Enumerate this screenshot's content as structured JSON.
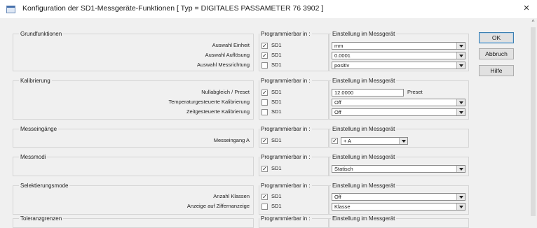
{
  "window": {
    "title": "Konfiguration der SD1-Messgeräte-Funktionen  [ Typ = DIGITALES PASSAMETER 76 3902 ]",
    "close_glyph": "×"
  },
  "column_headers": {
    "programmierbar": "Programmierbar in :",
    "einstellung": "Einstellung im Messgerät"
  },
  "sections": [
    {
      "title": "Grundfunktionen",
      "rows": [
        {
          "label": "Auswahl Einheit",
          "checked": true,
          "sd": "SD1",
          "value": "mm"
        },
        {
          "label": "Auswahl Auflösung",
          "checked": true,
          "sd": "SD1",
          "value": "0.0001"
        },
        {
          "label": "Auswahl Messrichtung",
          "checked": false,
          "sd": "SD1",
          "value": "positiv"
        }
      ]
    },
    {
      "title": "Kalibrierung",
      "rows": [
        {
          "label": "Nullabgleich / Preset",
          "checked": true,
          "sd": "SD1",
          "value": "12.0000",
          "suffix": "Preset"
        },
        {
          "label": "Temperaturgesteuerte Kalibrierung",
          "checked": false,
          "sd": "SD1",
          "value": "Off"
        },
        {
          "label": "Zeitgesteuerte Kalibrierung",
          "checked": false,
          "sd": "SD1",
          "value": "Off"
        }
      ]
    },
    {
      "title": "Messeingänge",
      "rows": [
        {
          "label": "Messeingang A",
          "checked": true,
          "sd": "SD1",
          "value_checked": true,
          "value": "+ A"
        }
      ]
    },
    {
      "title": "Messmodi",
      "rows": [
        {
          "label": "",
          "checked": true,
          "sd": "SD1",
          "value": "Statisch"
        }
      ]
    },
    {
      "title": "Selektierungsmode",
      "rows": [
        {
          "label": "Anzahl Klassen",
          "checked": true,
          "sd": "SD1",
          "value": "Off"
        },
        {
          "label": "Anzeige auf Ziffernanzeige",
          "checked": false,
          "sd": "SD1",
          "value": "Klasse"
        }
      ]
    },
    {
      "title": "Toleranzgrenzen",
      "rows": []
    }
  ],
  "buttons": {
    "ok": "OK",
    "abbruch": "Abbruch",
    "hilfe": "Hilfe"
  },
  "scrollbar": {
    "up_glyph": "^"
  }
}
